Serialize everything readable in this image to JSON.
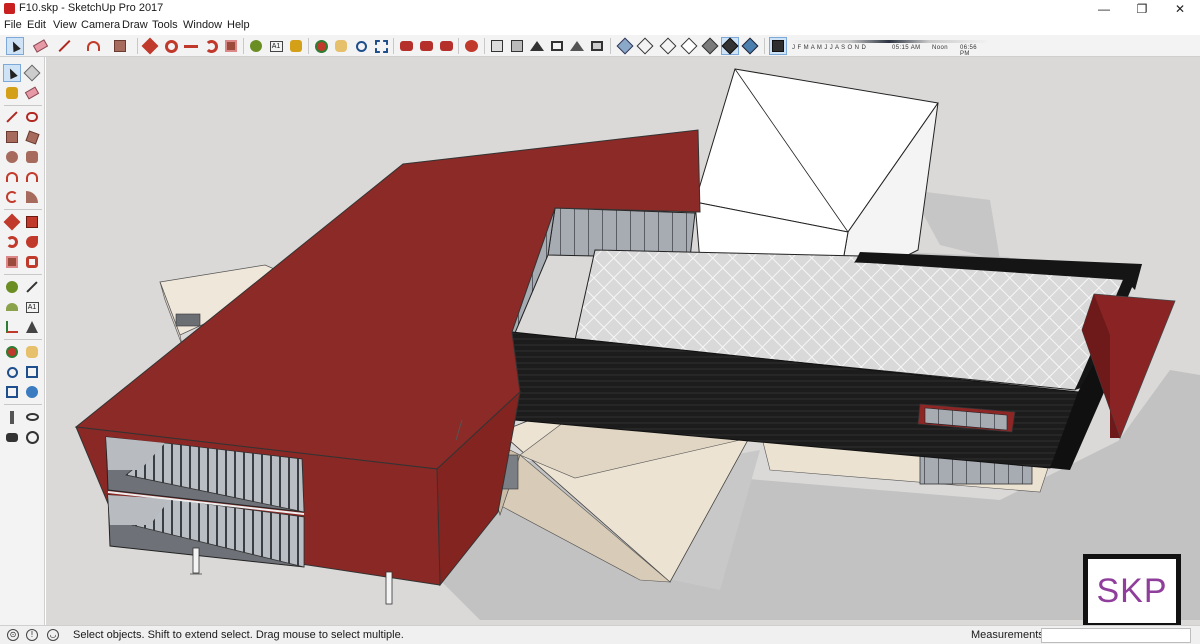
{
  "window": {
    "title": "F10.skp - SketchUp Pro 2017",
    "minimize": "—",
    "maximize": "❐",
    "close": "✕"
  },
  "menu": [
    "File",
    "Edit",
    "View",
    "Camera",
    "Draw",
    "Tools",
    "Window",
    "Help"
  ],
  "shadow_settings": {
    "months": "J F M A M J J A S O N D",
    "time_start": "05:15 AM",
    "time_mid": "Noon",
    "time_end": "06:56 PM"
  },
  "status": {
    "message": "Select objects. Shift to extend select. Drag mouse to select multiple.",
    "measurements_label": "Measurements",
    "measurements_value": ""
  },
  "watermark": {
    "text": "SKP"
  },
  "icons": {
    "toolbar": [
      "select-icon",
      "eraser-icon",
      "line-icon",
      "arc-icon",
      "shape-icon",
      "push-pull-icon",
      "move-icon",
      "rotate-icon",
      "scale-icon",
      "offset-icon",
      "tape-measure-icon",
      "text-icon",
      "paint-bucket-icon",
      "orbit-icon",
      "pan-icon",
      "zoom-icon",
      "zoom-extents-icon",
      "warehouse-icon",
      "extension-icon",
      "iso-view-icon",
      "top-view-icon",
      "front-view-icon",
      "right-view-icon",
      "back-view-icon",
      "left-view-icon",
      "xray-icon",
      "wireframe-icon",
      "hidden-line-icon",
      "shaded-icon",
      "shaded-textures-icon",
      "monochrome-icon",
      "shadows-icon"
    ],
    "left": [
      "select-icon",
      "make-component-icon",
      "paint-bucket-icon",
      "eraser-icon",
      "line-icon",
      "freehand-icon",
      "rectangle-icon",
      "rotated-rect-icon",
      "circle-icon",
      "polygon-icon",
      "arc-icon",
      "two-point-arc-icon",
      "three-point-arc-icon",
      "pie-icon",
      "move-icon",
      "push-pull-icon",
      "rotate-icon",
      "follow-me-icon",
      "scale-icon",
      "offset-icon",
      "tape-measure-icon",
      "dimension-icon",
      "protractor-icon",
      "text-icon",
      "axes-icon",
      "3d-text-icon",
      "orbit-icon",
      "pan-icon",
      "zoom-icon",
      "zoom-window-icon",
      "zoom-extents-icon",
      "previous-view-icon",
      "position-camera-icon",
      "look-around-icon",
      "walk-icon",
      "section-plane-icon"
    ]
  }
}
